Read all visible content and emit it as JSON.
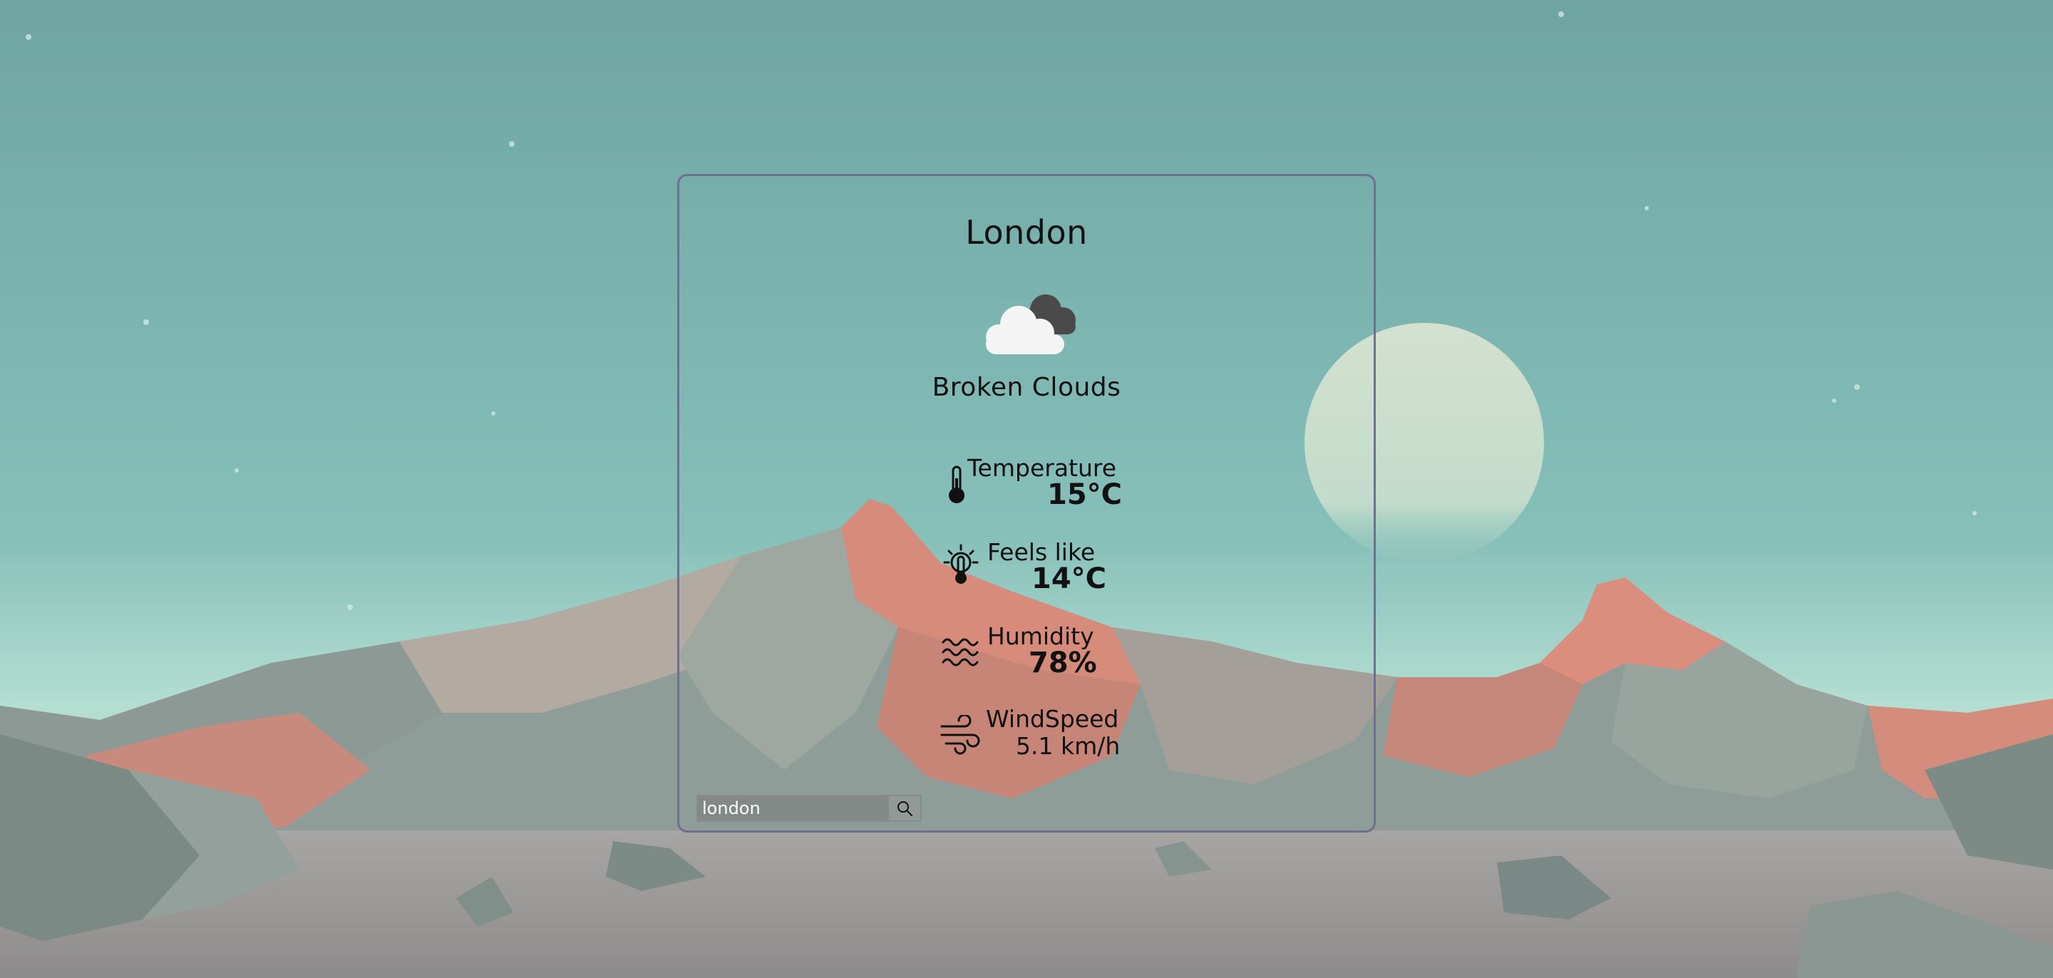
{
  "weather": {
    "city": "London",
    "icon": "broken-clouds-icon",
    "description": "Broken Clouds"
  },
  "stats": {
    "temperature": {
      "label": "Temperature",
      "value": "15°C",
      "icon": "thermometer-icon"
    },
    "feels_like": {
      "label": "Feels like",
      "value": "14°C",
      "icon": "sun-thermometer-icon"
    },
    "humidity": {
      "label": "Humidity",
      "value": "78%",
      "icon": "humidity-waves-icon"
    },
    "wind_speed": {
      "label": "WindSpeed",
      "value": "5.1 km/h",
      "icon": "wind-icon"
    }
  },
  "search": {
    "value": "london",
    "placeholder": "",
    "button_icon": "search-icon"
  },
  "colors": {
    "sky_top": "#6fa6a3",
    "sky_bottom": "#b8e0d2",
    "mountain_pink": "#d98a7a",
    "mountain_gray": "#8e9e98",
    "card_border": "#6f6f8f",
    "text": "#111111"
  }
}
